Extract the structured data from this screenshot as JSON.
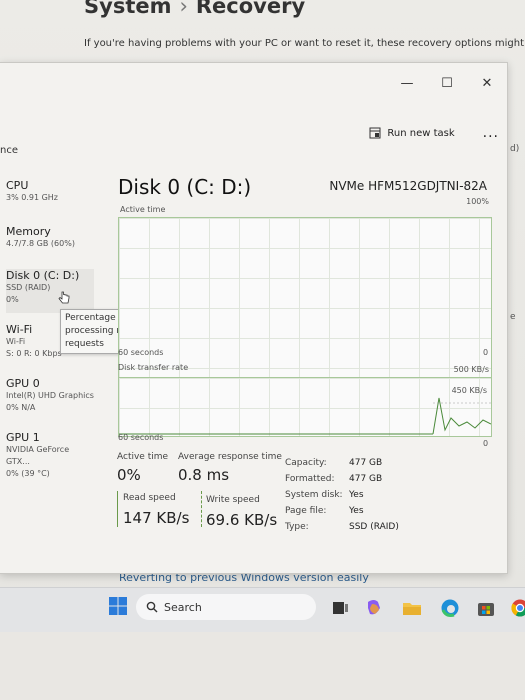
{
  "settings": {
    "title": "System",
    "sub_page": "Recovery",
    "description": "If you're having problems with your PC or want to reset it, these recovery options might he",
    "left_fragment_er": "er",
    "left_fragment_nce": "nce",
    "right_fragment_d": "d)",
    "right_fragment_e": "e",
    "revert_link": "Reverting to previous Windows version easily"
  },
  "task_manager": {
    "caption": {
      "minimize": "—",
      "maximize": "☐",
      "close": "✕"
    },
    "toolbar": {
      "run_new_task": "Run new task",
      "more": "..."
    },
    "perf_items": [
      {
        "name": "CPU",
        "sub1": "3% 0.91 GHz",
        "sub2": ""
      },
      {
        "name": "Memory",
        "sub1": "4.7/7.8 GB (60%)",
        "sub2": ""
      },
      {
        "name": "Disk 0 (C: D:)",
        "sub1": "SSD (RAID)",
        "sub2": "0%"
      },
      {
        "name": "Wi-Fi",
        "sub1": "Wi-Fi",
        "sub2": "S: 0 R: 0 Kbps"
      },
      {
        "name": "GPU 0",
        "sub1": "Intel(R) UHD Graphics",
        "sub2": "0% N/A"
      },
      {
        "name": "GPU 1",
        "sub1": "NVIDIA GeForce GTX...",
        "sub2": "0% (39 °C)"
      }
    ],
    "tooltip": "Percentage of time the disk is processing read or write requests",
    "disk": {
      "title": "Disk 0 (C: D:)",
      "model": "NVMe HFM512GDJTNI-82A",
      "graph1": {
        "label": "Active time",
        "max": "100%",
        "duration": "60 seconds",
        "min": "0"
      },
      "graph2": {
        "label": "Disk transfer rate",
        "max": "500 KB/s",
        "inner": "450 KB/s",
        "duration": "60 seconds",
        "min": "0"
      },
      "stats": {
        "active_time_label": "Active time",
        "active_time_value": "0%",
        "avg_response_label": "Average response time",
        "avg_response_value": "0.8 ms",
        "read_speed_label": "Read speed",
        "read_speed_value": "147 KB/s",
        "write_speed_label": "Write speed",
        "write_speed_value": "69.6 KB/s"
      },
      "properties": [
        {
          "key": "Capacity:",
          "value": "477 GB"
        },
        {
          "key": "Formatted:",
          "value": "477 GB"
        },
        {
          "key": "System disk:",
          "value": "Yes"
        },
        {
          "key": "Page file:",
          "value": "Yes"
        },
        {
          "key": "Type:",
          "value": "SSD (RAID)"
        }
      ]
    }
  },
  "taskbar": {
    "search_placeholder": "Search",
    "icons": [
      "start-icon",
      "search-icon",
      "task-view-icon",
      "copilot-icon",
      "file-explorer-icon",
      "edge-icon",
      "store-icon",
      "chrome-icon"
    ]
  }
}
